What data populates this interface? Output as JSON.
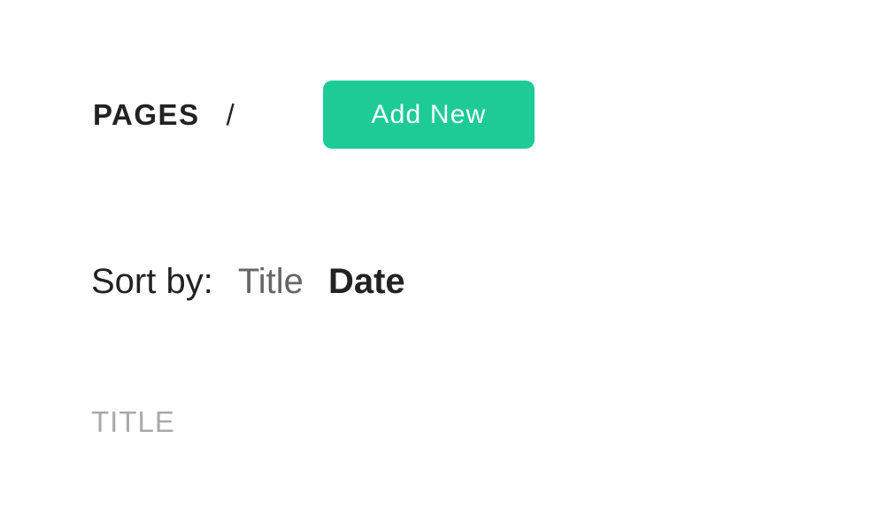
{
  "header": {
    "breadcrumb_root": "PAGES",
    "breadcrumb_separator": "/",
    "add_button_label": "Add New"
  },
  "sort": {
    "label": "Sort by:",
    "options": [
      {
        "label": "Title",
        "active": false
      },
      {
        "label": "Date",
        "active": true
      }
    ]
  },
  "table": {
    "column_title": "TITLE"
  },
  "colors": {
    "accent": "#1ecb97",
    "text_primary": "#222222",
    "text_secondary": "#666666",
    "text_muted": "#aaaaaa"
  }
}
